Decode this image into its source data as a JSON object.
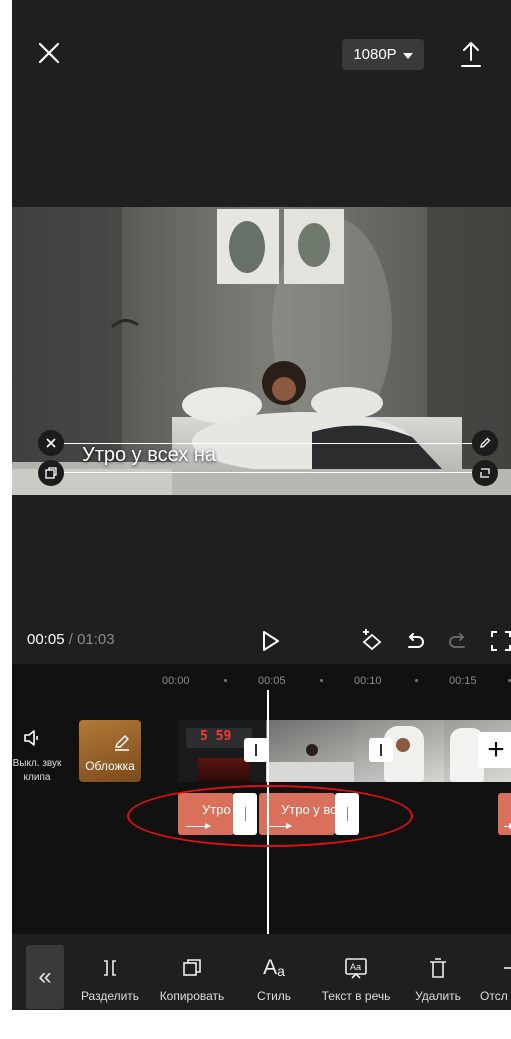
{
  "top_bar": {
    "resolution": "1080P"
  },
  "caption": {
    "text": "Утро у всех на"
  },
  "playback": {
    "current": "00:05",
    "separator": " / ",
    "total": "01:03"
  },
  "ruler": {
    "ticks": [
      "00:00",
      "00:05",
      "00:10",
      "00:15"
    ]
  },
  "track": {
    "mute_label": "Выкл. звук клипа",
    "cover_label": "Обложка",
    "clock_digits": "5 59"
  },
  "text_clips": [
    {
      "label": "Утро"
    },
    {
      "label": "Утро у вс"
    }
  ],
  "toolbar": {
    "tools": [
      {
        "label": "Разделить",
        "icon": "split-icon"
      },
      {
        "label": "Копировать",
        "icon": "copy-icon"
      },
      {
        "label": "Стиль",
        "icon": "text-style-icon"
      },
      {
        "label": "Текст в речь",
        "icon": "text-to-speech-icon"
      },
      {
        "label": "Удалить",
        "icon": "trash-icon"
      },
      {
        "label": "Отсл",
        "icon": "track-icon"
      }
    ]
  },
  "colors": {
    "accent_clip": "#d9705c",
    "annotation_ring": "#e01010",
    "background": "#1f1f1f"
  }
}
